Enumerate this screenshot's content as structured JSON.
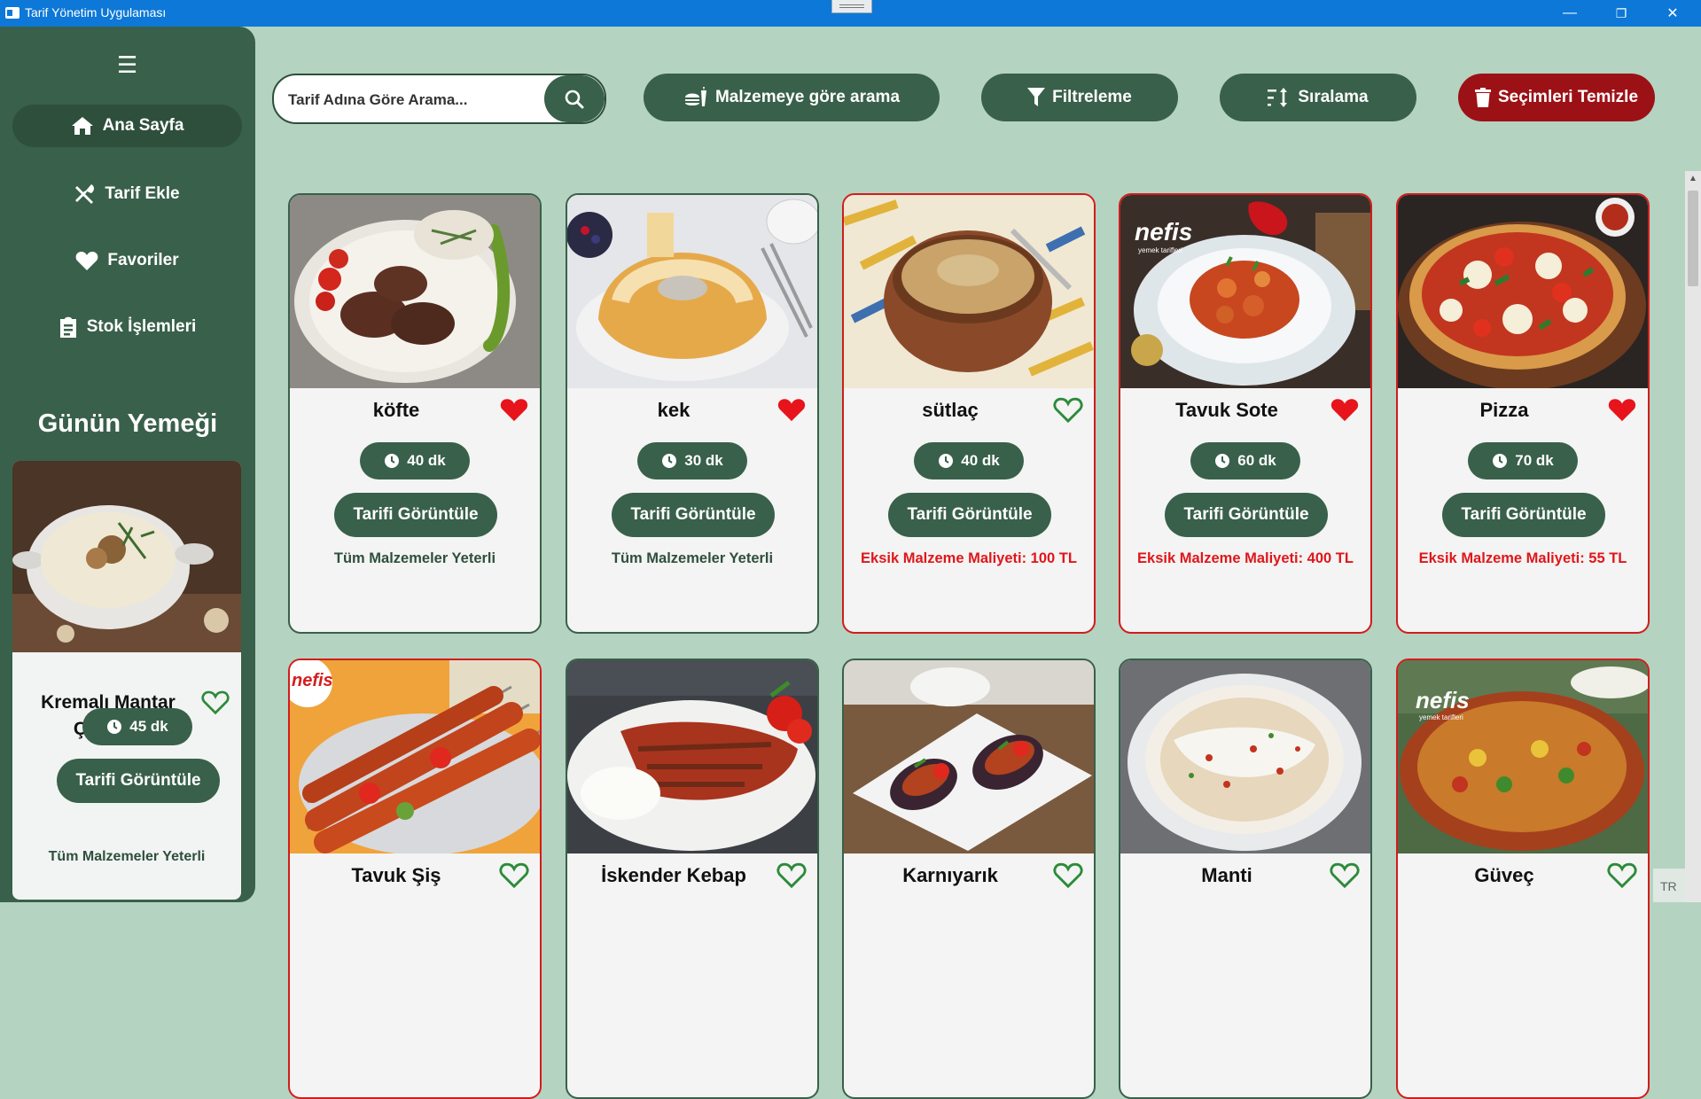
{
  "window": {
    "title": "Tarif Yönetim Uygulaması",
    "minimize_glyph": "—",
    "restore_glyph": "❐",
    "close_glyph": "✕"
  },
  "sidebar": {
    "menu_glyph": "☰",
    "items": [
      {
        "label": "Ana Sayfa",
        "icon": "home-icon",
        "active": true
      },
      {
        "label": "Tarif Ekle",
        "icon": "utensils-icon",
        "active": false
      },
      {
        "label": "Favoriler",
        "icon": "heart-icon",
        "active": false
      },
      {
        "label": "Stok İşlemleri",
        "icon": "clipboard-icon",
        "active": false
      }
    ],
    "daily": {
      "title": "Günün Yemeği",
      "name": "Kremalı Mantar Çorbası",
      "time": "45 dk",
      "button": "Tarifi Görüntüle",
      "status": "Tüm Malzemeler Yeterli",
      "favorite": false
    }
  },
  "toolbar": {
    "search_placeholder": "Tarif Adına Göre Arama...",
    "ingredient_search": "Malzemeye göre arama",
    "filter": "Filtreleme",
    "sort": "Sıralama",
    "clear": "Seçimleri Temizle"
  },
  "cards": [
    {
      "name": "köfte",
      "time": "40 dk",
      "button": "Tarifi Görüntüle",
      "status": "Tüm Malzemeler Yeterli",
      "favorite": true,
      "missing": false
    },
    {
      "name": "kek",
      "time": "30 dk",
      "button": "Tarifi Görüntüle",
      "status": "Tüm Malzemeler Yeterli",
      "favorite": true,
      "missing": false
    },
    {
      "name": "sütlaç",
      "time": "40 dk",
      "button": "Tarifi Görüntüle",
      "status": "Eksik Malzeme Maliyeti: 100 TL",
      "favorite": false,
      "missing": true
    },
    {
      "name": "Tavuk Sote",
      "time": "60 dk",
      "button": "Tarifi Görüntüle",
      "status": "Eksik Malzeme Maliyeti: 400 TL",
      "favorite": true,
      "missing": true
    },
    {
      "name": "Pizza",
      "time": "70 dk",
      "button": "Tarifi Görüntüle",
      "status": "Eksik Malzeme Maliyeti: 55 TL",
      "favorite": true,
      "missing": true
    },
    {
      "name": "Tavuk Şiş",
      "favorite": false,
      "missing": true
    },
    {
      "name": "İskender Kebap",
      "favorite": false,
      "missing": false
    },
    {
      "name": "Karnıyarık",
      "favorite": false,
      "missing": false
    },
    {
      "name": "Manti",
      "favorite": false,
      "missing": false
    },
    {
      "name": "Güveç",
      "favorite": false,
      "missing": true
    }
  ],
  "image_overlays": {
    "brand_logo": "nefis",
    "brand_sub": "yemek tarifleri"
  },
  "system": {
    "language": "TR"
  },
  "colors": {
    "background": "#b4d3c1",
    "sidebar": "#39604a",
    "accent": "#39604a",
    "danger": "#9c1116",
    "missing_text": "#e0161b",
    "heart_filled": "#e8141b"
  }
}
